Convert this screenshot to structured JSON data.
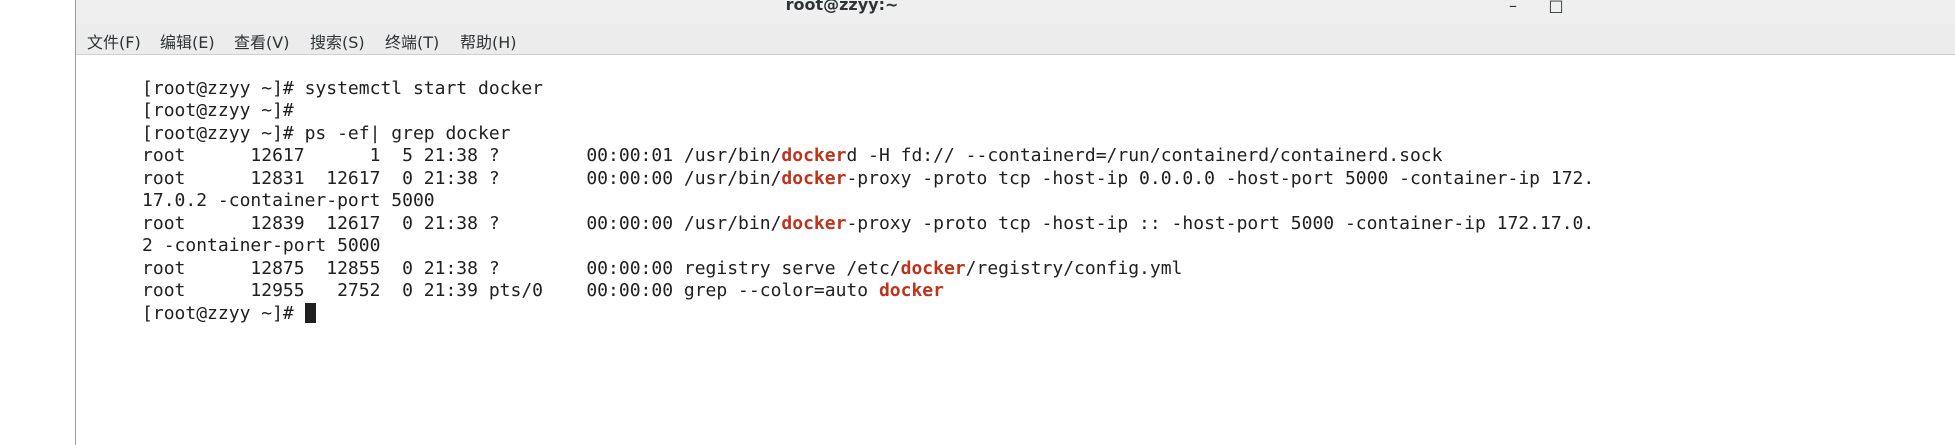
{
  "window": {
    "title": "root@zzyy:~",
    "minimize_glyph": "–",
    "maximize_glyph": "□"
  },
  "menu": [
    {
      "label": "文件(F)"
    },
    {
      "label": "编辑(E)"
    },
    {
      "label": "查看(V)"
    },
    {
      "label": "搜索(S)"
    },
    {
      "label": "终端(T)"
    },
    {
      "label": "帮助(H)"
    }
  ],
  "terminal": {
    "highlight_color": "#c0321a",
    "lines": [
      {
        "pre": "[root@zzyy ~]# systemctl start docker",
        "hl": "",
        "post": ""
      },
      {
        "pre": "[root@zzyy ~]#",
        "hl": "",
        "post": ""
      },
      {
        "pre": "[root@zzyy ~]# ps -ef| grep docker",
        "hl": "",
        "post": ""
      },
      {
        "pre": "root      12617      1  5 21:38 ?        00:00:01 /usr/bin/",
        "hl": "docker",
        "post": "d -H fd:// --containerd=/run/containerd/containerd.sock"
      },
      {
        "pre": "root      12831  12617  0 21:38 ?        00:00:00 /usr/bin/",
        "hl": "docker",
        "post": "-proxy -proto tcp -host-ip 0.0.0.0 -host-port 5000 -container-ip 172."
      },
      {
        "pre": "17.0.2 -container-port 5000",
        "hl": "",
        "post": ""
      },
      {
        "pre": "root      12839  12617  0 21:38 ?        00:00:00 /usr/bin/",
        "hl": "docker",
        "post": "-proxy -proto tcp -host-ip :: -host-port 5000 -container-ip 172.17.0."
      },
      {
        "pre": "2 -container-port 5000",
        "hl": "",
        "post": ""
      },
      {
        "pre": "root      12875  12855  0 21:38 ?        00:00:00 registry serve /etc/",
        "hl": "docker",
        "post": "/registry/config.yml"
      },
      {
        "pre": "root      12955   2752  0 21:39 pts/0    00:00:00 grep --color=auto ",
        "hl": "docker",
        "post": ""
      },
      {
        "pre": "[root@zzyy ~]# ",
        "hl": "",
        "post": ""
      }
    ]
  }
}
